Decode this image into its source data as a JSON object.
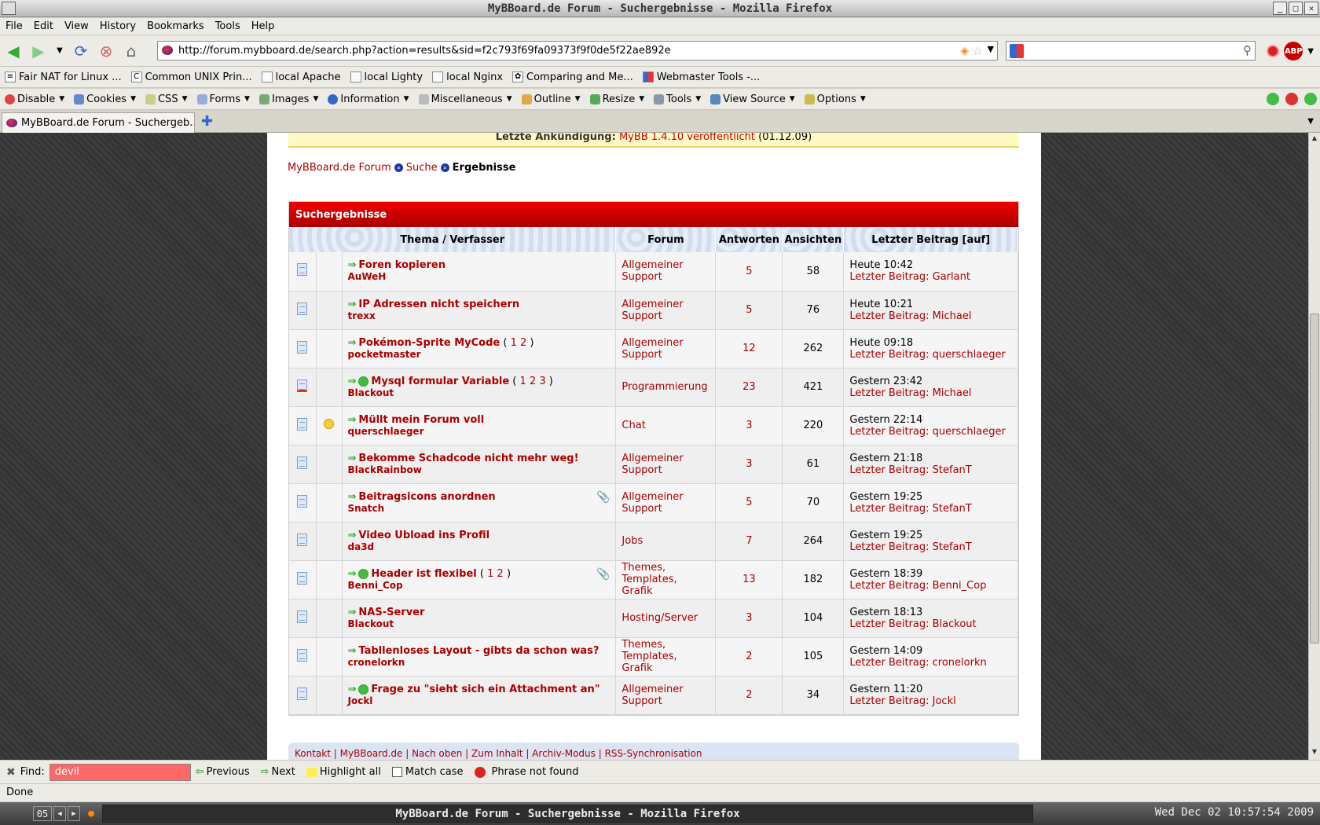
{
  "window": {
    "title": "MyBBoard.de Forum - Suchergebnisse - Mozilla Firefox"
  },
  "menu": [
    "File",
    "Edit",
    "View",
    "History",
    "Bookmarks",
    "Tools",
    "Help"
  ],
  "nav": {
    "url": "http://forum.mybboard.de/search.php?action=results&sid=f2c793f69fa09373f9f0de5f22ae892e",
    "search_value": ""
  },
  "bookmarks": [
    "Fair NAT for Linux ...",
    "Common UNIX Prin...",
    "local Apache",
    "local Lighty",
    "local Nginx",
    "Comparing and Me...",
    "Webmaster Tools -..."
  ],
  "devtools": [
    "Disable",
    "Cookies",
    "CSS",
    "Forms",
    "Images",
    "Information",
    "Miscellaneous",
    "Outline",
    "Resize",
    "Tools",
    "View Source",
    "Options"
  ],
  "tab": {
    "label": "MyBBoard.de Forum - Suchergeb..."
  },
  "page": {
    "announcement_label": "Letzte Ankündigung:",
    "announcement_link": "MyBB 1.4.10 veröffentlicht",
    "announcement_date": "(01.12.09)",
    "breadcrumb": [
      "MyBBoard.de Forum",
      "Suche",
      "Ergebnisse"
    ],
    "results_title": "Suchergebnisse",
    "columns": [
      "Thema / Verfasser",
      "Forum",
      "Antworten",
      "Ansichten",
      "Letzter Beitrag [auf]"
    ],
    "last_post_label": "Letzter Beitrag:",
    "rows": [
      {
        "title": "Foren kopieren",
        "author": "AuWeH",
        "pages": "",
        "forum": "Allgemeiner Support",
        "answers": "5",
        "views": "58",
        "date": "Heute 10:42",
        "by": "Garlant"
      },
      {
        "title": "IP Adressen nicht speichern",
        "author": "trexx",
        "pages": "",
        "forum": "Allgemeiner Support",
        "answers": "5",
        "views": "76",
        "date": "Heute 10:21",
        "by": "Michael"
      },
      {
        "title": "Pokémon-Sprite MyCode",
        "author": "pocketmaster",
        "pages": "1 2",
        "forum": "Allgemeiner Support",
        "answers": "12",
        "views": "262",
        "date": "Heute 09:18",
        "by": "querschlaeger"
      },
      {
        "title": "Mysql formular Variable",
        "author": "Blackout",
        "pages": "1 2 3",
        "forum": "Programmierung",
        "answers": "23",
        "views": "421",
        "date": "Gestern 23:42",
        "by": "Michael"
      },
      {
        "title": "Müllt mein Forum voll",
        "author": "querschlaeger",
        "pages": "",
        "forum": "Chat",
        "answers": "3",
        "views": "220",
        "date": "Gestern 22:14",
        "by": "querschlaeger"
      },
      {
        "title": "Bekomme Schadcode nicht mehr weg!",
        "author": "BlackRainbow",
        "pages": "",
        "forum": "Allgemeiner Support",
        "answers": "3",
        "views": "61",
        "date": "Gestern 21:18",
        "by": "StefanT"
      },
      {
        "title": "Beitragsicons anordnen",
        "author": "Snatch",
        "pages": "",
        "forum": "Allgemeiner Support",
        "answers": "5",
        "views": "70",
        "date": "Gestern 19:25",
        "by": "StefanT"
      },
      {
        "title": "Video Ubload ins Profil",
        "author": "da3d",
        "pages": "",
        "forum": "Jobs",
        "answers": "7",
        "views": "264",
        "date": "Gestern 19:25",
        "by": "StefanT"
      },
      {
        "title": "Header ist flexibel",
        "author": "Benni_Cop",
        "pages": "1 2",
        "forum": "Themes, Templates, Grafik",
        "answers": "13",
        "views": "182",
        "date": "Gestern 18:39",
        "by": "Benni_Cop"
      },
      {
        "title": "NAS-Server",
        "author": "Blackout",
        "pages": "",
        "forum": "Hosting/Server",
        "answers": "3",
        "views": "104",
        "date": "Gestern 18:13",
        "by": "Blackout"
      },
      {
        "title": "Tabllenloses Layout - gibts da schon was?",
        "author": "cronelorkn",
        "pages": "",
        "forum": "Themes, Templates, Grafik",
        "answers": "2",
        "views": "105",
        "date": "Gestern 14:09",
        "by": "cronelorkn"
      },
      {
        "title": "Frage zu \"sieht sich ein Attachment an\"",
        "author": "Jockl",
        "pages": "",
        "forum": "Allgemeiner Support",
        "answers": "2",
        "views": "34",
        "date": "Gestern 11:20",
        "by": "Jockl"
      }
    ],
    "footer_links": [
      "Kontakt",
      "MyBBoard.de",
      "Nach oben",
      "Zum Inhalt",
      "Archiv-Modus",
      "RSS-Synchronisation"
    ]
  },
  "find": {
    "label": "Find:",
    "value": "devil",
    "previous": "Previous",
    "next": "Next",
    "highlight": "Highlight all",
    "match_case": "Match case",
    "status": "Phrase not found"
  },
  "status": "Done",
  "taskbar": {
    "workspace": "05",
    "task": "MyBBoard.de Forum - Suchergebnisse - Mozilla Firefox",
    "clock": "Wed Dec 02 10:57:54 2009"
  }
}
